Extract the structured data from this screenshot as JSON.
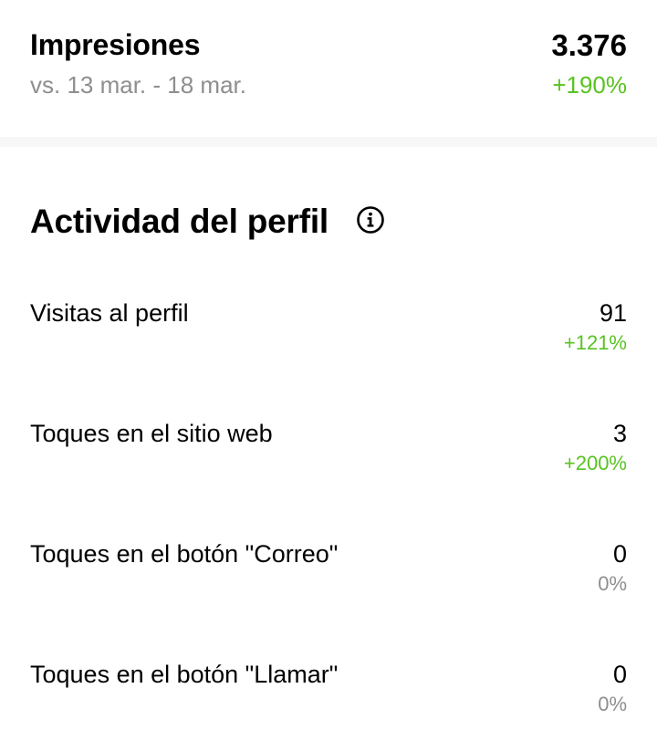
{
  "impressions": {
    "title": "Impresiones",
    "comparison": "vs. 13 mar. - 18 mar.",
    "value": "3.376",
    "change": "+190%"
  },
  "profile_activity": {
    "title": "Actividad del perfil",
    "info_icon": "info-circle-icon",
    "metrics": [
      {
        "label": "Visitas al perfil",
        "value": "91",
        "change": "+121%",
        "trend": "positive"
      },
      {
        "label": "Toques en el sitio web",
        "value": "3",
        "change": "+200%",
        "trend": "positive"
      },
      {
        "label": "Toques en el botón \"Correo\"",
        "value": "0",
        "change": "0%",
        "trend": "neutral"
      },
      {
        "label": "Toques en el botón \"Llamar\"",
        "value": "0",
        "change": "0%",
        "trend": "neutral"
      }
    ]
  },
  "colors": {
    "positive": "#58c322",
    "neutral": "#8e8e8e",
    "text": "#000000"
  }
}
